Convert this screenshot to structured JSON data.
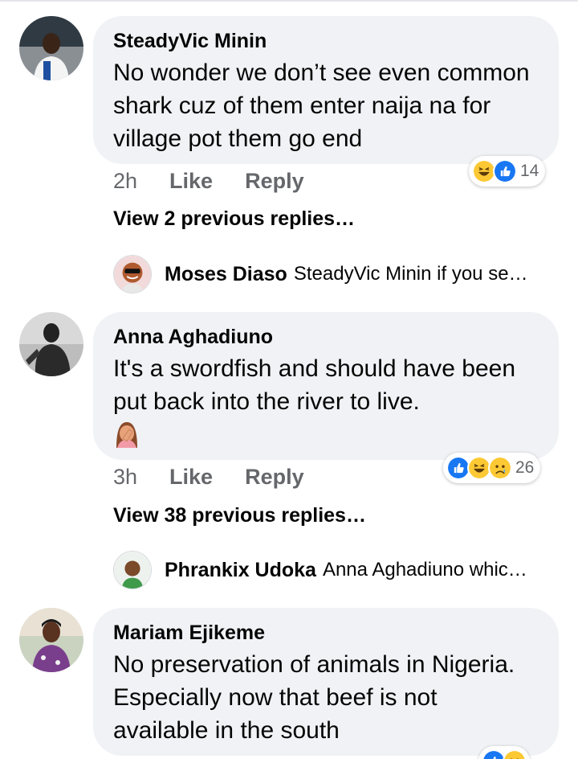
{
  "comments": [
    {
      "author": "SteadyVic Minin",
      "text": "No wonder we don’t see even common shark cuz of them enter naija na for village pot them go end",
      "time": "2h",
      "like_label": "Like",
      "reply_label": "Reply",
      "reaction_icons": [
        "haha-icon",
        "like-icon"
      ],
      "reaction_count": "14",
      "view_replies": "View 2 previous replies…",
      "latest_reply": {
        "author": "Moses Diaso",
        "text": "SteadyVic Minin if you se…"
      }
    },
    {
      "author": "Anna Aghadiuno",
      "text": "It's a swordfish and should have been put back into the river to live.",
      "emoji": "facepalm-emoji",
      "time": "3h",
      "like_label": "Like",
      "reply_label": "Reply",
      "reaction_icons": [
        "like-icon",
        "haha-icon",
        "sad-icon"
      ],
      "reaction_count": "26",
      "view_replies": "View 38 previous replies…",
      "latest_reply": {
        "author": "Phrankix Udoka",
        "text": "Anna Aghadiuno whic…"
      }
    },
    {
      "author": "Mariam Ejikeme",
      "text": "No preservation of animals in Nigeria. Especially now that beef is not available in the south",
      "reaction_icons": [
        "like-icon",
        "sad-icon"
      ]
    }
  ],
  "colors": {
    "bubble": "#f0f2f5",
    "meta_text": "#65676b",
    "like_blue": "#1877f2",
    "emoji_yellow": "#fcc934"
  }
}
